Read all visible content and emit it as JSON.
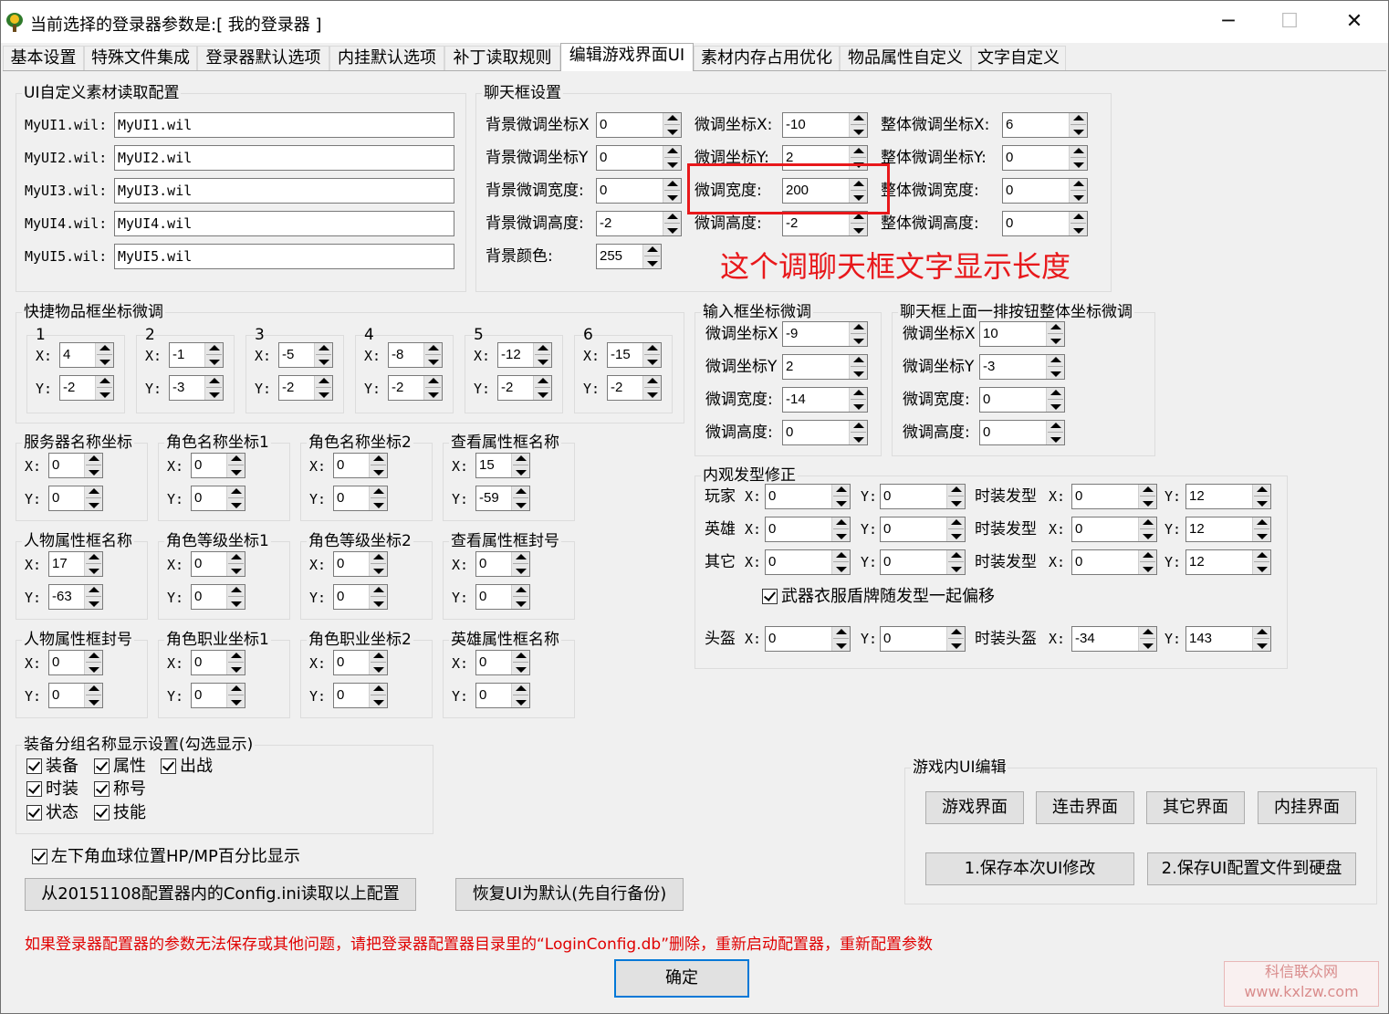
{
  "window": {
    "title": "当前选择的登录器参数是:[ 我的登录器 ]",
    "min": "─",
    "max": "☐",
    "close": "✕"
  },
  "tabs": [
    "基本设置",
    "特殊文件集成",
    "登录器默认选项",
    "内挂默认选项",
    "补丁读取规则",
    "编辑游戏界面UI",
    "素材内存占用优化",
    "物品属性自定义",
    "文字自定义"
  ],
  "ui_files": {
    "title": "UI自定义素材读取配置",
    "rows": [
      {
        "label": "MyUI1.wil:",
        "value": "MyUI1.wil"
      },
      {
        "label": "MyUI2.wil:",
        "value": "MyUI2.wil"
      },
      {
        "label": "MyUI3.wil:",
        "value": "MyUI3.wil"
      },
      {
        "label": "MyUI4.wil:",
        "value": "MyUI4.wil"
      },
      {
        "label": "MyUI5.wil:",
        "value": "MyUI5.wil"
      }
    ]
  },
  "chat": {
    "title": "聊天框设置",
    "c1": [
      {
        "label": "背景微调坐标X",
        "value": "0"
      },
      {
        "label": "背景微调坐标Y",
        "value": "0"
      },
      {
        "label": "背景微调宽度:",
        "value": "0"
      },
      {
        "label": "背景微调高度:",
        "value": "-2"
      },
      {
        "label": "背景颜色:",
        "value": "255"
      }
    ],
    "c2": [
      {
        "label": "微调坐标X:",
        "value": "-10"
      },
      {
        "label": "微调坐标Y:",
        "value": "2"
      },
      {
        "label": "微调宽度:",
        "value": "200"
      },
      {
        "label": "微调高度:",
        "value": "-2"
      }
    ],
    "c3": [
      {
        "label": "整体微调坐标X:",
        "value": "6"
      },
      {
        "label": "整体微调坐标Y:",
        "value": "0"
      },
      {
        "label": "整体微调宽度:",
        "value": "0"
      },
      {
        "label": "整体微调高度:",
        "value": "0"
      }
    ]
  },
  "annotation": "这个调聊天框文字显示长度",
  "quick": {
    "title": "快捷物品框坐标微调",
    "xl": "X:",
    "yl": "Y:",
    "slots": [
      {
        "n": "1",
        "x": "4",
        "y": "-2"
      },
      {
        "n": "2",
        "x": "-1",
        "y": "-3"
      },
      {
        "n": "3",
        "x": "-5",
        "y": "-2"
      },
      {
        "n": "4",
        "x": "-8",
        "y": "-2"
      },
      {
        "n": "5",
        "x": "-12",
        "y": "-2"
      },
      {
        "n": "6",
        "x": "-15",
        "y": "-2"
      }
    ]
  },
  "coords": [
    {
      "title": "服务器名称坐标",
      "x": "0",
      "y": "0"
    },
    {
      "title": "角色名称坐标1",
      "x": "0",
      "y": "0"
    },
    {
      "title": "角色名称坐标2",
      "x": "0",
      "y": "0"
    },
    {
      "title": "查看属性框名称",
      "x": "15",
      "y": "-59"
    },
    {
      "title": "人物属性框名称",
      "x": "17",
      "y": "-63"
    },
    {
      "title": "角色等级坐标1",
      "x": "0",
      "y": "0"
    },
    {
      "title": "角色等级坐标2",
      "x": "0",
      "y": "0"
    },
    {
      "title": "查看属性框封号",
      "x": "0",
      "y": "0"
    },
    {
      "title": "人物属性框封号",
      "x": "0",
      "y": "0"
    },
    {
      "title": "角色职业坐标1",
      "x": "0",
      "y": "0"
    },
    {
      "title": "角色职业坐标2",
      "x": "0",
      "y": "0"
    },
    {
      "title": "英雄属性框名称",
      "x": "0",
      "y": "0"
    }
  ],
  "input": {
    "title": "输入框坐标微调",
    "rows": [
      {
        "label": "微调坐标X",
        "value": "-9"
      },
      {
        "label": "微调坐标Y",
        "value": "2"
      },
      {
        "label": "微调宽度:",
        "value": "-14"
      },
      {
        "label": "微调高度:",
        "value": "0"
      }
    ]
  },
  "chatbtns": {
    "title": "聊天框上面一排按钮整体坐标微调",
    "rows": [
      {
        "label": "微调坐标X",
        "value": "10"
      },
      {
        "label": "微调坐标Y",
        "value": "-3"
      },
      {
        "label": "微调宽度:",
        "value": "0"
      },
      {
        "label": "微调高度:",
        "value": "0"
      }
    ]
  },
  "hair": {
    "title": "内观发型修正",
    "xl": "X:",
    "yl": "Y:",
    "rows": [
      {
        "label": "玩家",
        "x": "0",
        "y": "0",
        "fl": "时装发型",
        "fx": "0",
        "fy": "12"
      },
      {
        "label": "英雄",
        "x": "0",
        "y": "0",
        "fl": "时装发型",
        "fx": "0",
        "fy": "12"
      },
      {
        "label": "其它",
        "x": "0",
        "y": "0",
        "fl": "时装发型",
        "fx": "0",
        "fy": "12"
      }
    ],
    "check": "武器衣服盾牌随发型一起偏移",
    "helmet": {
      "label": "头盔",
      "x": "0",
      "y": "0",
      "fl": "时装头盔",
      "fx": "-34",
      "fy": "143"
    }
  },
  "equip": {
    "title": "装备分组名称显示设置(勾选显示)",
    "items": [
      "装备",
      "属性",
      "出战",
      "时装",
      "称号",
      "状态",
      "技能"
    ]
  },
  "hp_check": "左下角血球位置HP/MP百分比显示",
  "buttons": {
    "read": "从20151108配置器内的Config.ini读取以上配置",
    "restore": "恢复UI为默认(先自行备份)"
  },
  "ingame": {
    "title": "游戏内UI编辑",
    "b1": "游戏界面",
    "b2": "连击界面",
    "b3": "其它界面",
    "b4": "内挂界面",
    "save1": "1.保存本次UI修改",
    "save2": "2.保存UI配置文件到硬盘"
  },
  "warning": "如果登录器配置器的参数无法保存或其他问题，请把登录器配置器目录里的“LoginConfig.db”删除，重新启动配置器，重新配置参数",
  "ok": "确定",
  "watermark": {
    "line1": "科信联众网",
    "line2": "www.kxlzw.com"
  }
}
